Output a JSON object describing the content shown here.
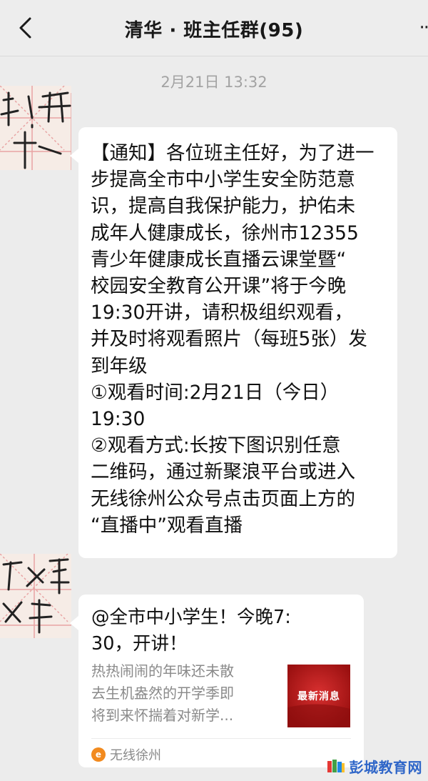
{
  "header": {
    "title": "清华 · 班主任群(95)",
    "more": "··"
  },
  "chat": {
    "timestamp": "2月21日 13:32",
    "message_lines": [
      "【通知】各位班主任好，为了进一",
      "步提高全市中小学生安全防范意",
      "识，提高自我保护能力，护佑未",
      "成年人健康成长，徐州市12355",
      "青少年健康成长直播云课堂暨“",
      "校园安全教育公开课”将于今晚",
      "19:30开讲，请积极组织观看，",
      "并及时将观看照片（每班5张）发",
      "到年级",
      "①观看时间:2月21日（今日）",
      "19:30",
      "②观看方式:长按下图识别任意",
      "二维码，通过新聚浪平台或进入",
      "无线徐州公众号点击页面上方的",
      "“直播中”观看直播"
    ],
    "share_card": {
      "title_lines": [
        "@全市中小学生！今晚7:",
        "30，开讲！"
      ],
      "desc_lines": [
        "热热闹闹的年味还未散",
        "去生机盎然的开学季即",
        "将到来怀揣着对新学..."
      ],
      "thumbnail_text": "最新消息",
      "source_icon": "e",
      "source_name": "无线徐州"
    }
  },
  "watermark": {
    "text": "彭城教育网"
  },
  "colors": {
    "background": "#ececec",
    "bubble": "#ffffff",
    "thumbnail": "#b21a1a",
    "source_icon": "#f28a1e",
    "watermark": "#2f66c8"
  }
}
